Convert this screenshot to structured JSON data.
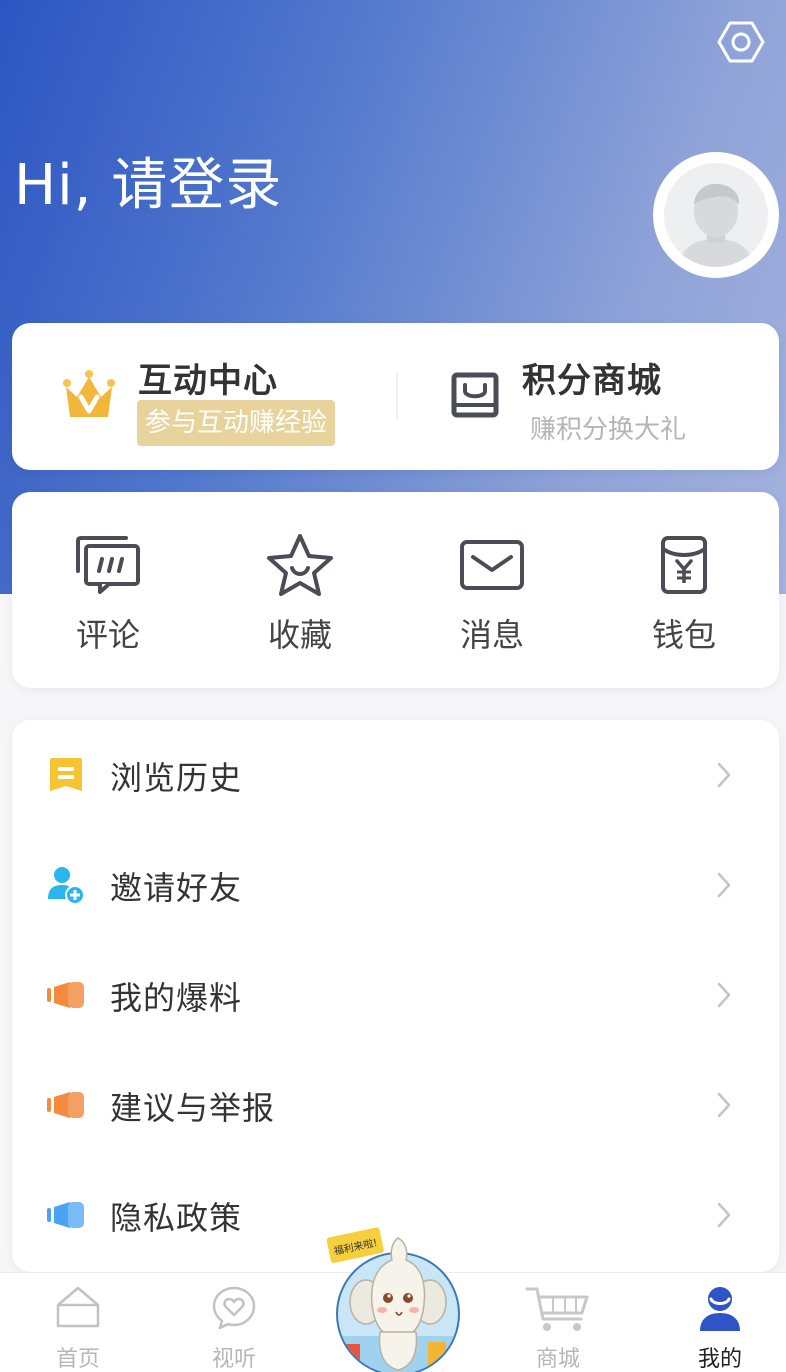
{
  "header": {
    "greeting": "Hi, 请登录",
    "settings_icon": "settings-hex-icon",
    "avatar_icon": "default-avatar-icon"
  },
  "promo": {
    "left": {
      "title": "互动中心",
      "badge": "参与互动赚经验",
      "icon": "crown-icon"
    },
    "right": {
      "title": "积分商城",
      "subtitle": "赚积分换大礼",
      "icon": "shopping-bag-icon"
    }
  },
  "quick_actions": [
    {
      "label": "评论",
      "icon": "comment-icon"
    },
    {
      "label": "收藏",
      "icon": "star-icon"
    },
    {
      "label": "消息",
      "icon": "mail-icon"
    },
    {
      "label": "钱包",
      "icon": "wallet-icon"
    }
  ],
  "menu": [
    {
      "label": "浏览历史",
      "icon": "history-icon"
    },
    {
      "label": "邀请好友",
      "icon": "invite-user-icon"
    },
    {
      "label": "我的爆料",
      "icon": "megaphone-icon"
    },
    {
      "label": "建议与举报",
      "icon": "megaphone-icon"
    },
    {
      "label": "隐私政策",
      "icon": "megaphone-icon"
    }
  ],
  "tabbar": {
    "items": [
      {
        "label": "首页",
        "icon": "home-icon"
      },
      {
        "label": "视听",
        "icon": "heart-play-icon"
      },
      {
        "label": "",
        "icon": "mascot-icon"
      },
      {
        "label": "商城",
        "icon": "cart-icon"
      },
      {
        "label": "我的",
        "icon": "profile-icon"
      }
    ],
    "mascot_sign": "福利来啦!",
    "active_index": 4
  },
  "colors": {
    "hero_gradient_start": "#2c55c2",
    "hero_gradient_end": "#a4b2de",
    "badge_bg": "#e8d39d",
    "crown": "#f0b73a",
    "history_icon": "#f6c431",
    "invite_icon": "#29b5ee",
    "megaphone_orange": "#f5893d",
    "megaphone_blue": "#4aa3f2",
    "active_tab": "#2f54c8"
  }
}
